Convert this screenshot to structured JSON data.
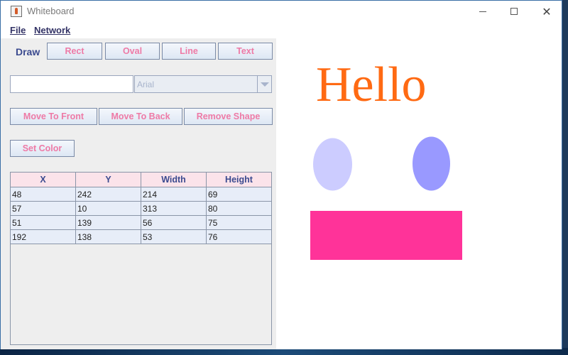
{
  "window": {
    "title": "Whiteboard"
  },
  "menu": {
    "file": "File",
    "network": "Network"
  },
  "toolbar": {
    "draw_label": "Draw",
    "rect": "Rect",
    "oval": "Oval",
    "line": "Line",
    "text": "Text"
  },
  "text_input": {
    "value": ""
  },
  "font_select": {
    "value": "Arial"
  },
  "actions": {
    "move_front": "Move To Front",
    "move_back": "Move To Back",
    "remove": "Remove Shape",
    "set_color": "Set Color"
  },
  "table": {
    "headers": [
      "X",
      "Y",
      "Width",
      "Height"
    ],
    "rows": [
      [
        "48",
        "242",
        "214",
        "69"
      ],
      [
        "57",
        "10",
        "313",
        "80"
      ],
      [
        "51",
        "139",
        "56",
        "75"
      ],
      [
        "192",
        "138",
        "53",
        "76"
      ]
    ]
  },
  "canvas": {
    "text_shape": "Hello",
    "colors": {
      "text": "#ff6a13",
      "oval_light": "#ccccff",
      "oval_dark": "#9999ff",
      "rect": "#ff3399"
    }
  },
  "icons": {
    "app": "java-coffee-icon",
    "minimize": "minimize-icon",
    "maximize": "maximize-icon",
    "close": "close-icon",
    "dropdown": "chevron-down-icon"
  }
}
